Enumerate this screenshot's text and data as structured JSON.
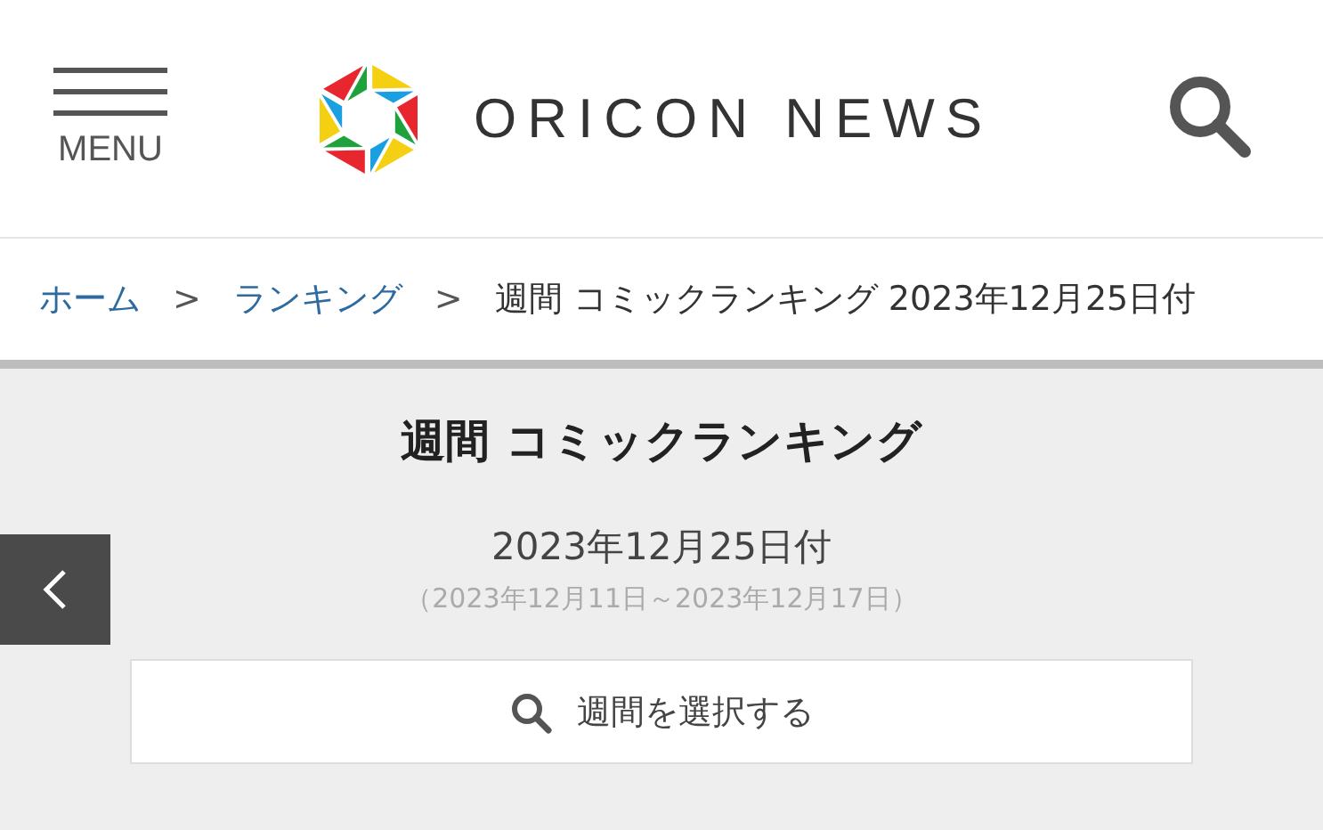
{
  "header": {
    "menu_label": "MENU",
    "logo_text": "ORICON NEWS"
  },
  "breadcrumb": [
    {
      "label": "ホーム",
      "kind": "link"
    },
    {
      "label": ">",
      "kind": "separator"
    },
    {
      "label": "ランキング",
      "kind": "link"
    },
    {
      "label": ">",
      "kind": "separator"
    },
    {
      "label": "週間 コミックランキング 2023年12月25日付",
      "kind": "current"
    }
  ],
  "ranking": {
    "title": "週間 コミックランキング",
    "date": "2023年12月25日付",
    "period": "（2023年12月11日～2023年12月17日）",
    "select_button": "週間を選択する"
  }
}
